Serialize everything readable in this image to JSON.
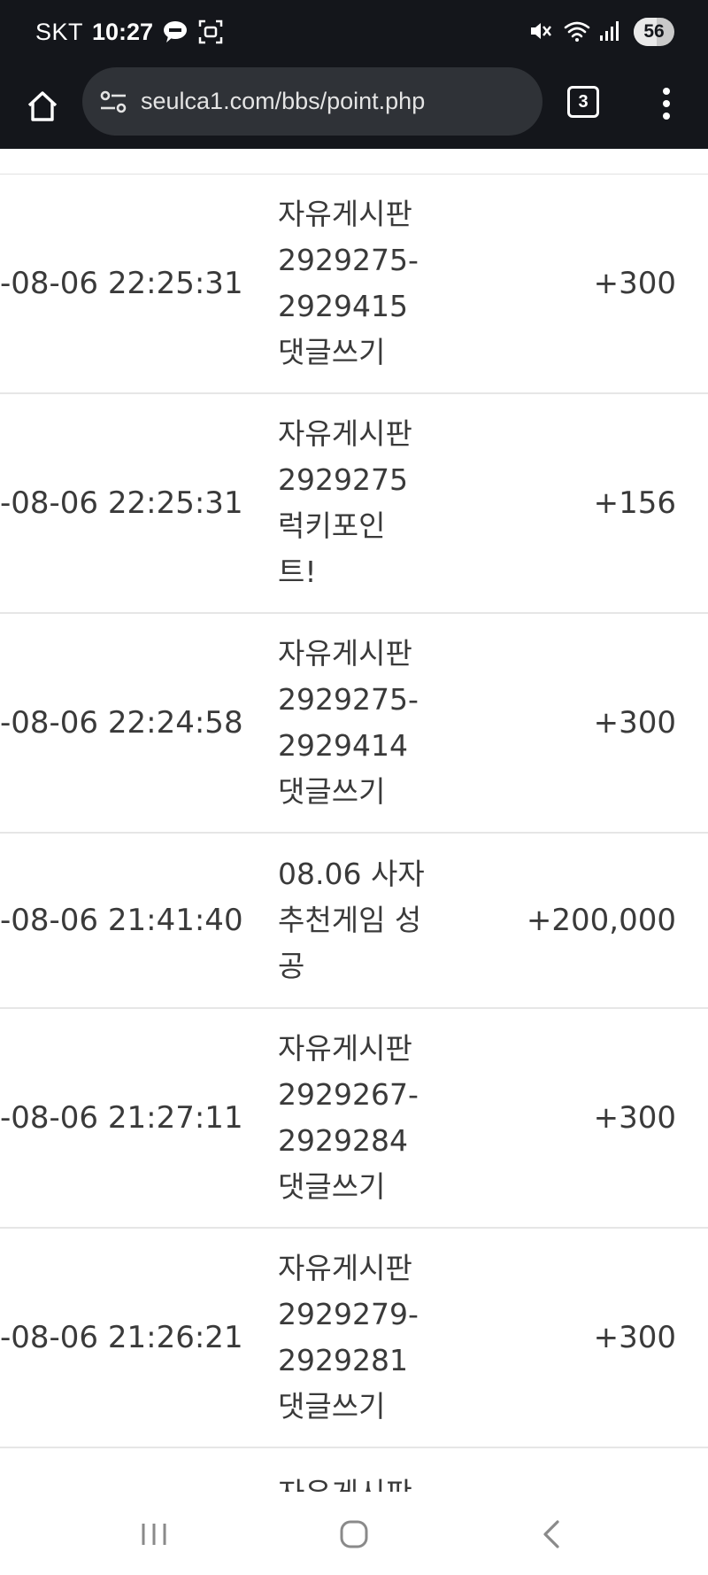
{
  "status_bar": {
    "carrier": "SKT",
    "time": "10:27",
    "battery": "56",
    "battery_level": 0.56,
    "icons": [
      "talk-icon",
      "screen-capture-icon",
      "mute-icon",
      "wifi-icon",
      "signal-icon"
    ]
  },
  "browser": {
    "url": "seulca1.com/bbs/point.php",
    "tab_count": "3"
  },
  "points_table": {
    "rows": [
      {
        "date": "-08-06 22:25:31",
        "description": "자유게시판\n2929275-\n2929415\n댓글쓰기",
        "point": "+300"
      },
      {
        "date": "-08-06 22:25:31",
        "description": "자유게시판\n2929275\n럭키포인\n트!",
        "point": "+156"
      },
      {
        "date": "-08-06 22:24:58",
        "description": "자유게시판\n2929275-\n2929414\n댓글쓰기",
        "point": "+300"
      },
      {
        "date": "-08-06 21:41:40",
        "description": "08.06 사자\n추천게임 성\n공",
        "point": "+200,000"
      },
      {
        "date": "-08-06 21:27:11",
        "description": "자유게시판\n2929267-\n2929284\n댓글쓰기",
        "point": "+300"
      },
      {
        "date": "-08-06 21:26:21",
        "description": "자유게시판\n2929279-\n2929281\n댓글쓰기",
        "point": "+300"
      }
    ],
    "partial_row_description": "자유게시판"
  },
  "colors": {
    "status_bar_bg": "#14161b",
    "url_bar_bg": "#2f3237",
    "text": "#3a3a3a",
    "divider": "#e6e6e6"
  }
}
